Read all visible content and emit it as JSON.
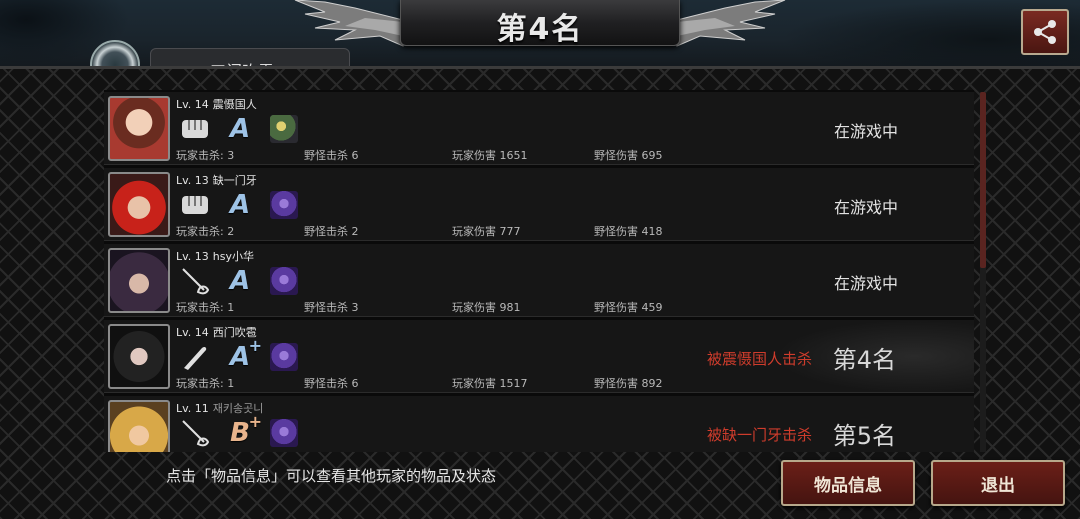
{
  "header": {
    "title": "第4名",
    "mode_tab": "工门吹雪"
  },
  "players": [
    {
      "level": "Lv. 14",
      "name": "震慑国人",
      "weapon_icon": "fist-icon",
      "grade": "A",
      "grade_plus": "",
      "pet_icon": "pet-bird-icon",
      "player_kills": "玩家击杀: 3",
      "monster_kills": "野怪击杀 6",
      "player_damage": "玩家伤害 1651",
      "monster_damage": "野怪伤害 695",
      "status": "在游戏中",
      "killed_by": "",
      "rank": ""
    },
    {
      "level": "Lv. 13",
      "name": "缺一门牙",
      "weapon_icon": "fist-icon",
      "grade": "A",
      "grade_plus": "",
      "pet_icon": "pet-wolf-icon",
      "player_kills": "玩家击杀: 2",
      "monster_kills": "野怪击杀 2",
      "player_damage": "玩家伤害 777",
      "monster_damage": "野怪伤害 418",
      "status": "在游戏中",
      "killed_by": "",
      "rank": ""
    },
    {
      "level": "Lv. 13",
      "name": "hsy小华",
      "weapon_icon": "rapier-icon",
      "grade": "A",
      "grade_plus": "",
      "pet_icon": "pet-wolf-icon",
      "player_kills": "玩家击杀: 1",
      "monster_kills": "野怪击杀 3",
      "player_damage": "玩家伤害 981",
      "monster_damage": "野怪伤害 459",
      "status": "在游戏中",
      "killed_by": "",
      "rank": ""
    },
    {
      "level": "Lv. 14",
      "name": "西门吹雹",
      "weapon_icon": "bat-icon",
      "grade": "A",
      "grade_plus": "+",
      "pet_icon": "pet-wolf-icon",
      "player_kills": "玩家击杀: 1",
      "monster_kills": "野怪击杀 6",
      "player_damage": "玩家伤害 1517",
      "monster_damage": "野怪伤害 892",
      "status": "",
      "killed_by": "被震慑国人击杀",
      "rank": "第4名"
    },
    {
      "level": "Lv. 11",
      "name": "재키송곳니",
      "weapon_icon": "rapier-icon",
      "grade": "B",
      "grade_plus": "+",
      "pet_icon": "pet-wolf-icon",
      "player_kills": "",
      "monster_kills": "",
      "player_damage": "",
      "monster_damage": "",
      "status": "",
      "killed_by": "被缺一门牙击杀",
      "rank": "第5名"
    }
  ],
  "hint": "点击「物品信息」可以查看其他玩家的物品及状态",
  "buttons": {
    "items": "物品信息",
    "exit": "退出"
  },
  "colors": {
    "button_red": "#6b1f18",
    "killed_text": "#cf3c2c",
    "grade_a": "#9ec3e6",
    "grade_b": "#e8b48c"
  }
}
